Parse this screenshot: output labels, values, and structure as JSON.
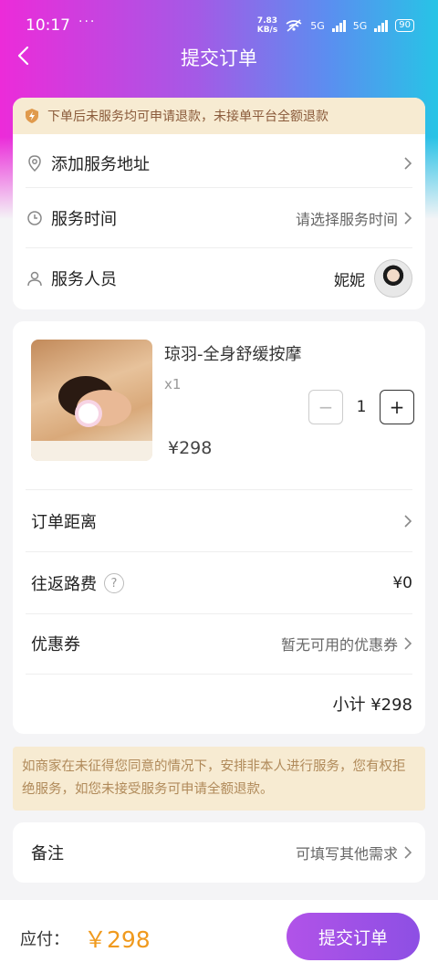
{
  "status_bar": {
    "time": "10:17",
    "dots": "···",
    "net_speed_value": "7.83",
    "net_speed_unit": "KB/s",
    "signal1": "5G",
    "signal2": "5G",
    "battery": "90"
  },
  "header": {
    "title": "提交订单"
  },
  "notice": {
    "text": "下单后未服务均可申请退款，未接单平台全额退款"
  },
  "service_info": {
    "address_label": "添加服务地址",
    "time_label": "服务时间",
    "time_placeholder": "请选择服务时间",
    "staff_label": "服务人员",
    "staff_name": "妮妮"
  },
  "product": {
    "name": "琼羽-全身舒缓按摩",
    "quantity_text": "x1",
    "price": "¥298",
    "quantity": "1",
    "minus": "−",
    "plus": "+"
  },
  "order_rows": {
    "distance_label": "订单距离",
    "travel_fee_label": "往返路费",
    "travel_fee_help": "?",
    "travel_fee_value": "¥0",
    "coupon_label": "优惠券",
    "coupon_value": "暂无可用的优惠券",
    "subtotal": "小计 ¥298"
  },
  "policy": {
    "text": "如商家在未征得您同意的情况下，安排非本人进行服务，您有权拒绝服务，如您未接受服务可申请全额退款。"
  },
  "remarks": {
    "label": "备注",
    "placeholder": "可填写其他需求"
  },
  "footer": {
    "pay_label": "应付：",
    "pay_amount": "￥298",
    "submit_label": "提交订单"
  },
  "colors": {
    "accent": "#8d4fe4",
    "price": "#f09a1e",
    "notice_bg": "#f7ebd2"
  }
}
